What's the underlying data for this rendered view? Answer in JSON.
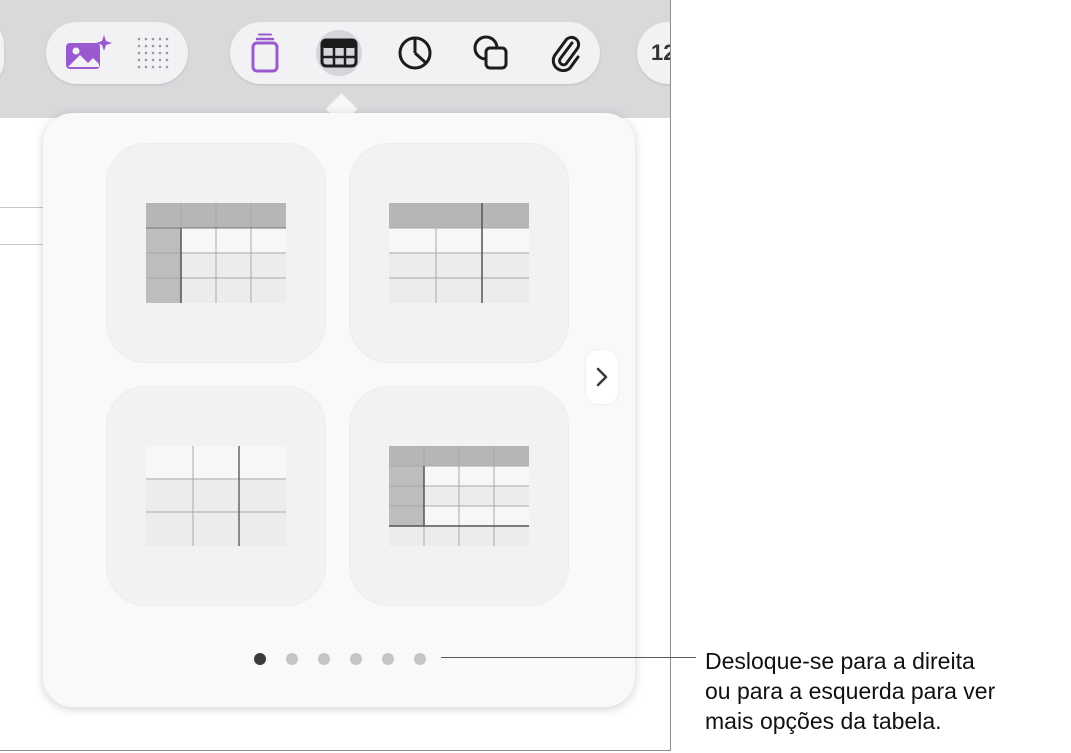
{
  "toolbar": {
    "groups": [
      {
        "name": "media",
        "items": [
          "image-magic-icon",
          "dot-grid-icon"
        ]
      },
      {
        "name": "insert",
        "items": [
          "text-box-icon",
          "table-icon",
          "chart-icon",
          "shape-icon",
          "attachment-icon"
        ],
        "active": "table-icon"
      },
      {
        "name": "partial",
        "label": "12"
      }
    ],
    "accent_color": "#9b59d0"
  },
  "popover": {
    "table_styles": [
      {
        "name": "header-row-and-column"
      },
      {
        "name": "header-row-wide-columns"
      },
      {
        "name": "plain-three-column"
      },
      {
        "name": "header-row-column-footer"
      }
    ],
    "page_dots": {
      "count": 6,
      "active_index": 0
    }
  },
  "callout": {
    "lines": [
      "Desloque-se para a direita",
      "ou para a esquerda para ver",
      "mais opções da tabela."
    ]
  }
}
